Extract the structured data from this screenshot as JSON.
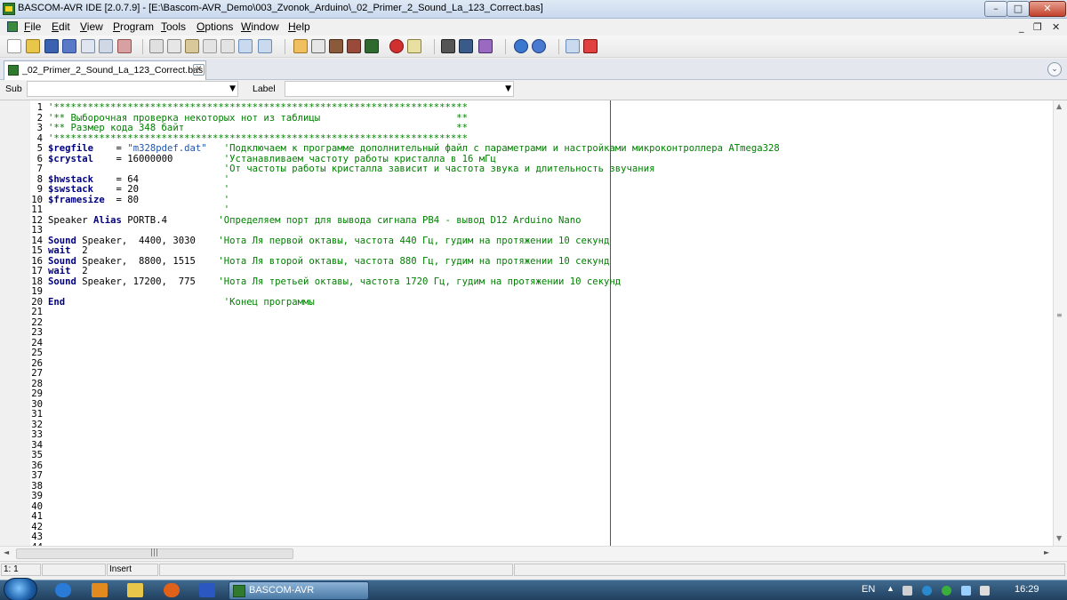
{
  "window": {
    "title": "BASCOM-AVR IDE [2.0.7.9] - [E:\\Bascom-AVR_Demo\\003_Zvonok_Arduino\\_02_Primer_2_Sound_La_123_Correct.bas]",
    "min_glyph": "–",
    "max_glyph": "□",
    "close_glyph": "✕"
  },
  "menu": {
    "items": [
      "File",
      "Edit",
      "View",
      "Program",
      "Tools",
      "Options",
      "Window",
      "Help"
    ],
    "mdi_min": "_",
    "mdi_restore": "❐",
    "mdi_close": "✕"
  },
  "tab": {
    "label": "_02_Primer_2_Sound_La_123_Correct.bas",
    "close_glyph": "✕",
    "menu_glyph": "⌄"
  },
  "subrow": {
    "sub_label": "Sub",
    "sub_value": "",
    "label_label": "Label",
    "label_value": "",
    "arrow": "▼"
  },
  "code_lines": [
    {
      "n": "1",
      "segs": [
        {
          "c": "cm",
          "t": "'*************************************************************************"
        }
      ]
    },
    {
      "n": "2",
      "segs": [
        {
          "c": "cm",
          "t": "'** Выборочная проверка некоторых нот из таблицы                        **"
        }
      ]
    },
    {
      "n": "3",
      "segs": [
        {
          "c": "cm",
          "t": "'** Размер кода 348 байт                                                **"
        }
      ]
    },
    {
      "n": "4",
      "segs": [
        {
          "c": "cm",
          "t": "'*************************************************************************"
        }
      ]
    },
    {
      "n": "5",
      "segs": [
        {
          "c": "kw",
          "t": "$regfile"
        },
        {
          "c": "plain",
          "t": "    = "
        },
        {
          "c": "str",
          "t": "\"m328pdef.dat\""
        },
        {
          "c": "plain",
          "t": "   "
        },
        {
          "c": "cm",
          "t": "'Подключаем к программе дополнительный файл с параметрами и настройками микроконтроллера ATmega328"
        }
      ]
    },
    {
      "n": "6",
      "segs": [
        {
          "c": "kw",
          "t": "$crystal"
        },
        {
          "c": "plain",
          "t": "    = 16000000         "
        },
        {
          "c": "cm",
          "t": "'Устанавливаем частоту работы кристалла в 16 мГц"
        }
      ]
    },
    {
      "n": "7",
      "segs": [
        {
          "c": "plain",
          "t": "                               "
        },
        {
          "c": "cm",
          "t": "'От частоты работы кристалла зависит и частота звука и длительность звучания"
        }
      ]
    },
    {
      "n": "8",
      "segs": [
        {
          "c": "kw",
          "t": "$hwstack"
        },
        {
          "c": "plain",
          "t": "    = 64               "
        },
        {
          "c": "cm",
          "t": "'"
        }
      ]
    },
    {
      "n": "9",
      "segs": [
        {
          "c": "kw",
          "t": "$swstack"
        },
        {
          "c": "plain",
          "t": "    = 20               "
        },
        {
          "c": "cm",
          "t": "'"
        }
      ]
    },
    {
      "n": "10",
      "segs": [
        {
          "c": "kw",
          "t": "$framesize"
        },
        {
          "c": "plain",
          "t": "  = 80               "
        },
        {
          "c": "cm",
          "t": "'"
        }
      ]
    },
    {
      "n": "11",
      "segs": [
        {
          "c": "plain",
          "t": "                               "
        },
        {
          "c": "cm",
          "t": "'"
        }
      ]
    },
    {
      "n": "12",
      "segs": [
        {
          "c": "plain",
          "t": "Speaker "
        },
        {
          "c": "kw",
          "t": "Alias"
        },
        {
          "c": "plain",
          "t": " PORTB.4         "
        },
        {
          "c": "cm",
          "t": "'Определяем порт для вывода сигнала PB4 - вывод D12 Arduino Nano"
        }
      ]
    },
    {
      "n": "13",
      "segs": []
    },
    {
      "n": "14",
      "segs": [
        {
          "c": "kw",
          "t": "Sound"
        },
        {
          "c": "plain",
          "t": " Speaker,  4400, 3030    "
        },
        {
          "c": "cm",
          "t": "'Нота Ля первой октавы, частота 440 Гц, гудим на протяжении 10 секунд"
        }
      ]
    },
    {
      "n": "15",
      "segs": [
        {
          "c": "kw",
          "t": "wait"
        },
        {
          "c": "plain",
          "t": "  2"
        }
      ]
    },
    {
      "n": "16",
      "segs": [
        {
          "c": "kw",
          "t": "Sound"
        },
        {
          "c": "plain",
          "t": " Speaker,  8800, 1515    "
        },
        {
          "c": "cm",
          "t": "'Нота Ля второй октавы, частота 880 Гц, гудим на протяжении 10 секунд"
        }
      ]
    },
    {
      "n": "17",
      "segs": [
        {
          "c": "kw",
          "t": "wait"
        },
        {
          "c": "plain",
          "t": "  2"
        }
      ]
    },
    {
      "n": "18",
      "segs": [
        {
          "c": "kw",
          "t": "Sound"
        },
        {
          "c": "plain",
          "t": " Speaker, 17200,  775    "
        },
        {
          "c": "cm",
          "t": "'Нота Ля третьей октавы, частота 1720 Гц, гудим на протяжении 10 секунд"
        }
      ]
    },
    {
      "n": "19",
      "segs": []
    },
    {
      "n": "20",
      "segs": [
        {
          "c": "kw",
          "t": "End"
        },
        {
          "c": "plain",
          "t": "                            "
        },
        {
          "c": "cm",
          "t": "'Конец программы"
        }
      ]
    },
    {
      "n": "21",
      "segs": []
    },
    {
      "n": "22",
      "segs": []
    },
    {
      "n": "23",
      "segs": []
    },
    {
      "n": "24",
      "segs": []
    },
    {
      "n": "25",
      "segs": []
    },
    {
      "n": "26",
      "segs": []
    },
    {
      "n": "27",
      "segs": []
    },
    {
      "n": "28",
      "segs": []
    },
    {
      "n": "29",
      "segs": []
    },
    {
      "n": "30",
      "segs": []
    },
    {
      "n": "31",
      "segs": []
    },
    {
      "n": "32",
      "segs": []
    },
    {
      "n": "33",
      "segs": []
    },
    {
      "n": "34",
      "segs": []
    },
    {
      "n": "35",
      "segs": []
    },
    {
      "n": "36",
      "segs": []
    },
    {
      "n": "37",
      "segs": []
    },
    {
      "n": "38",
      "segs": []
    },
    {
      "n": "39",
      "segs": []
    },
    {
      "n": "40",
      "segs": []
    },
    {
      "n": "41",
      "segs": []
    },
    {
      "n": "42",
      "segs": []
    },
    {
      "n": "43",
      "segs": []
    },
    {
      "n": "44",
      "segs": []
    }
  ],
  "scroll": {
    "up": "▲",
    "down": "▼",
    "left": "◄",
    "right": "►",
    "grip_v": "≡",
    "grip_h": "|||"
  },
  "status": {
    "position": "1: 1",
    "cell2": "",
    "mode": "Insert",
    "cell4": "",
    "cell5": ""
  },
  "taskbar": {
    "app_label": "BASCOM-AVR",
    "lang": "EN",
    "clock": "16:29",
    "tray_up": "▲"
  },
  "colors": {
    "keyword": "#000080",
    "comment": "#008000",
    "string": "#2255aa"
  }
}
